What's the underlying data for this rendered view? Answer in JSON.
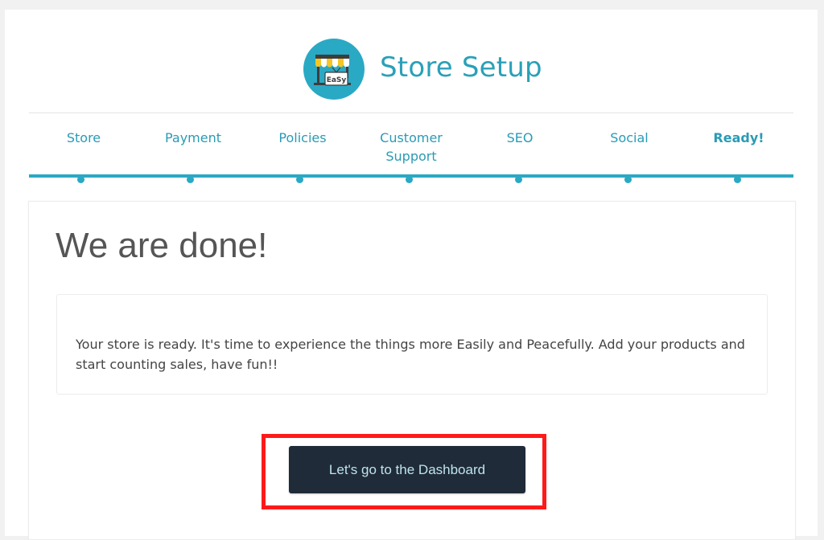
{
  "header": {
    "title": "Store Setup",
    "logo_icon": "store-awning-icon",
    "logo_text": "EaSy",
    "accent_color": "#2aa9c4"
  },
  "steps": [
    {
      "label": "Store",
      "active": false
    },
    {
      "label": "Payment",
      "active": false
    },
    {
      "label": "Policies",
      "active": false
    },
    {
      "label": "Customer Support",
      "active": false
    },
    {
      "label": "SEO",
      "active": false
    },
    {
      "label": "Social",
      "active": false
    },
    {
      "label": "Ready!",
      "active": true
    }
  ],
  "main": {
    "heading": "We are done!",
    "message": "Your store is ready. It's time to experience the things more Easily and Peacefully. Add your products and start counting sales, have fun!!",
    "button_label": "Let's go to the Dashboard",
    "button_color": "#1f2b38",
    "highlight_color": "#ff1a1a"
  }
}
